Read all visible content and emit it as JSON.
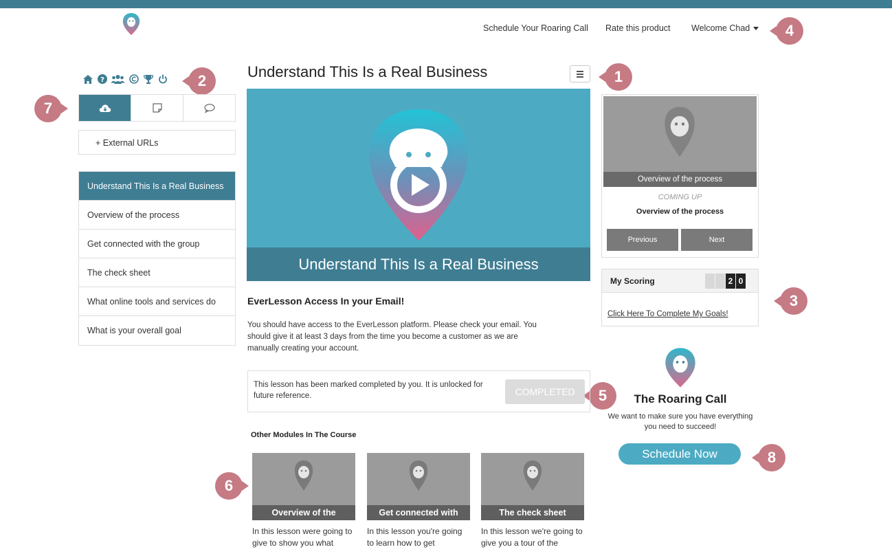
{
  "header": {
    "nav": [
      "Schedule Your Roaring Call",
      "Rate this product",
      "Welcome Chad"
    ]
  },
  "badges": [
    "1",
    "2",
    "3",
    "4",
    "5",
    "6",
    "7",
    "8"
  ],
  "sidebar": {
    "icons": [
      "home-icon",
      "help-icon",
      "group-icon",
      "copyright-icon",
      "trophy-icon",
      "power-icon"
    ],
    "tabs": [
      "cloud-download-icon",
      "note-icon",
      "comment-icon"
    ],
    "external_urls": "+ External URLs",
    "lessons": [
      "Understand This Is a Real Business",
      "Overview of the process",
      "Get connected with the group",
      "The check sheet",
      "What online tools and services do",
      "What is your overall goal"
    ]
  },
  "main": {
    "title": "Understand This Is a Real Business",
    "hero_caption": "Understand This Is a Real Business",
    "section_heading": "EverLesson Access In your Email!",
    "section_body": "You should have access to the EverLesson platform.  Please check your email. You should give it at least 3 days from the time you become a customer as we are manually creating your account.",
    "completed_text": "This lesson has been marked completed by you. It is unlocked for future reference.",
    "completed_button": "COMPLETED",
    "other_modules_heading": "Other Modules In The Course",
    "modules": [
      {
        "title": "Overview of the",
        "desc": "In this lesson were going to give to show you what"
      },
      {
        "title": "Get connected with",
        "desc": "In this lesson you're going to learn how to get"
      },
      {
        "title": "The check sheet",
        "desc": "In this lesson we're going to give you a tour of the"
      }
    ]
  },
  "right": {
    "upnext_thumb_label": "Overview of the process",
    "coming_up": "COMING UP",
    "next_title": "Overview of the process",
    "previous": "Previous",
    "next": "Next",
    "scoring_title": "My Scoring",
    "score_digits": [
      "2",
      "0"
    ],
    "goals_link": "Click Here To Complete My Goals!",
    "roaring_title": "The Roaring Call",
    "roaring_sub": "We want to make sure you have everything you need to succeed!",
    "schedule_button": "Schedule Now"
  },
  "colors": {
    "brand_dark": "#3f7d93",
    "brand_light": "#4cabc3",
    "badge": "#c57a84"
  }
}
